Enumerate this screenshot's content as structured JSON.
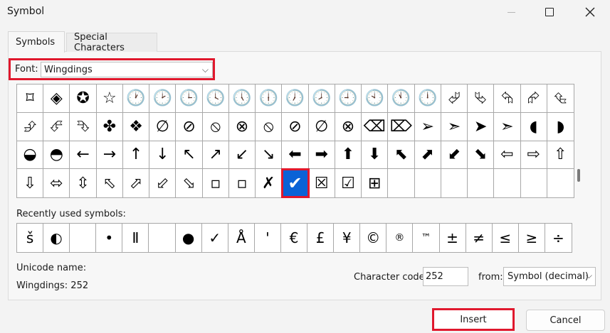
{
  "window": {
    "title": "Symbol"
  },
  "tabs": [
    {
      "label": "Symbols",
      "active": true
    },
    {
      "label": "Special Characters",
      "active": false
    }
  ],
  "font": {
    "label": "Font:",
    "value": "Wingdings"
  },
  "symbol_grid": {
    "rows": [
      [
        "⌑",
        "◈",
        "✪",
        "☆",
        "🕐",
        "🕑",
        "🕒",
        "🕓",
        "🕔",
        "🕕",
        "🕖",
        "🕗",
        "🕘",
        "🕙",
        "🕚",
        "🕛",
        "⮰",
        "⮱",
        "⮲",
        "⮳",
        "⮴"
      ],
      [
        "⮵",
        "⮶",
        "⮷",
        "✤",
        "❖",
        "∅",
        "⊘",
        "⦸",
        "⊗",
        "⦸",
        "⊘",
        "∅",
        "⊗",
        "⌫",
        "⌦",
        "➢",
        "➣",
        "➤",
        "➣",
        "◖",
        "◗"
      ],
      [
        "◒",
        "◓",
        "←",
        "→",
        "↑",
        "↓",
        "↖",
        "↗",
        "↙",
        "↘",
        "⬅",
        "➡",
        "⬆",
        "⬇",
        "⬉",
        "⬈",
        "⬋",
        "⬊",
        "⇦",
        "⇨",
        "⇧"
      ],
      [
        "⇩",
        "⬄",
        "⇳",
        "⬁",
        "⬀",
        "⬃",
        "⬂",
        "▫",
        "▫",
        "✗",
        "✔",
        "☒",
        "☑",
        "⊞",
        "",
        "",
        "",
        "",
        "",
        "",
        ""
      ]
    ],
    "selected": "✔"
  },
  "recent": {
    "label": "Recently used symbols:",
    "symbols": [
      "š",
      "◐",
      "",
      "•",
      "Ⅱ",
      "",
      "●",
      "✓",
      "Å",
      "'",
      "€",
      "£",
      "¥",
      "©",
      "®",
      "™",
      "±",
      "≠",
      "≤",
      "≥",
      "÷"
    ]
  },
  "unicode": {
    "label": "Unicode name:",
    "value": "Wingdings: 252"
  },
  "character_code": {
    "label": "Character code:",
    "value": "252"
  },
  "from": {
    "label": "from:",
    "value": "Symbol (decimal)"
  },
  "buttons": {
    "insert": "Insert",
    "cancel": "Cancel"
  },
  "icons": {
    "minimize": "minimize-icon",
    "maximize": "maximize-icon",
    "close": "close-icon"
  },
  "colors": {
    "highlight": "#e0182d",
    "selection": "#0a62d6"
  }
}
